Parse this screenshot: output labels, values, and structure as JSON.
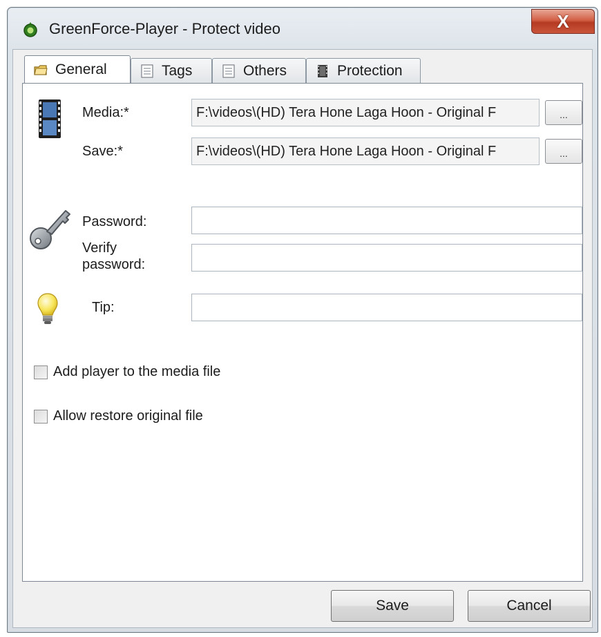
{
  "window": {
    "title": "GreenForce-Player - Protect video",
    "close_glyph": "X"
  },
  "tabs": [
    {
      "label": "General",
      "icon": "folder-icon",
      "active": true
    },
    {
      "label": "Tags",
      "icon": "list-icon",
      "active": false
    },
    {
      "label": "Others",
      "icon": "list-icon",
      "active": false
    },
    {
      "label": "Protection",
      "icon": "film-strip-icon",
      "active": false
    }
  ],
  "general": {
    "media_label": "Media:*",
    "media_value": "F:\\videos\\(HD) Tera Hone Laga Hoon - Original F",
    "save_label": "Save:*",
    "save_value": "F:\\videos\\(HD) Tera Hone Laga Hoon - Original F",
    "browse_label": "...",
    "password_label": "Password:",
    "password_value": "",
    "verify_label_1": "Verify",
    "verify_label_2": "password:",
    "verify_value": "",
    "tip_label": "Tip:",
    "tip_value": "",
    "add_player_label": "Add player to the media file",
    "add_player_checked": false,
    "allow_restore_label": "Allow restore original file",
    "allow_restore_checked": false
  },
  "footer": {
    "save_label": "Save",
    "cancel_label": "Cancel"
  },
  "icons": {
    "app": "greenforce-app-icon",
    "media": "film-icon",
    "password": "key-icon",
    "tip": "lightbulb-icon"
  }
}
